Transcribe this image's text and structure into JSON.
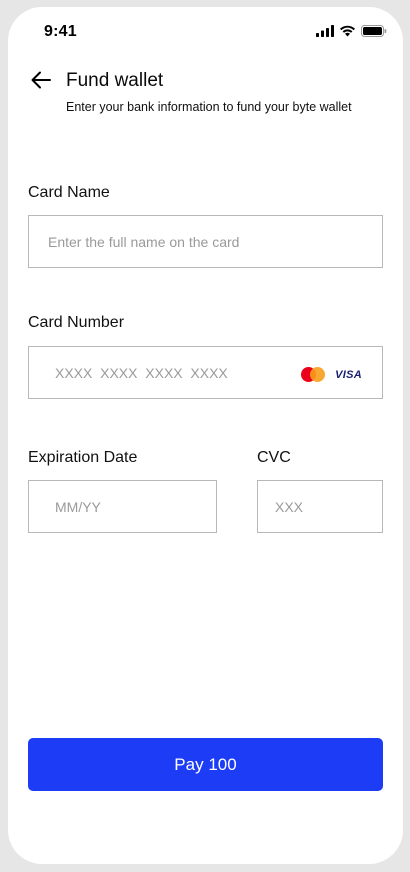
{
  "status_bar": {
    "time": "9:41"
  },
  "header": {
    "title": "Fund wallet",
    "subtitle": "Enter your bank information to fund your byte wallet"
  },
  "form": {
    "card_name": {
      "label": "Card Name",
      "placeholder": "Enter the full name on the card",
      "value": ""
    },
    "card_number": {
      "label": "Card Number",
      "placeholder": "XXXX  XXXX  XXXX  XXXX",
      "value": "",
      "brand_logos": [
        "mastercard",
        "VISA"
      ]
    },
    "expiration_date": {
      "label": "Expiration Date",
      "placeholder": "MM/YY",
      "value": ""
    },
    "cvc": {
      "label": "CVC",
      "placeholder": "XXX",
      "value": ""
    }
  },
  "pay_button": {
    "label": "Pay 100",
    "color": "#1c3cf5"
  },
  "icons": {
    "back": "arrow-left-icon",
    "signal": "cellular-signal-icon",
    "wifi": "wifi-icon",
    "battery": "battery-icon"
  }
}
